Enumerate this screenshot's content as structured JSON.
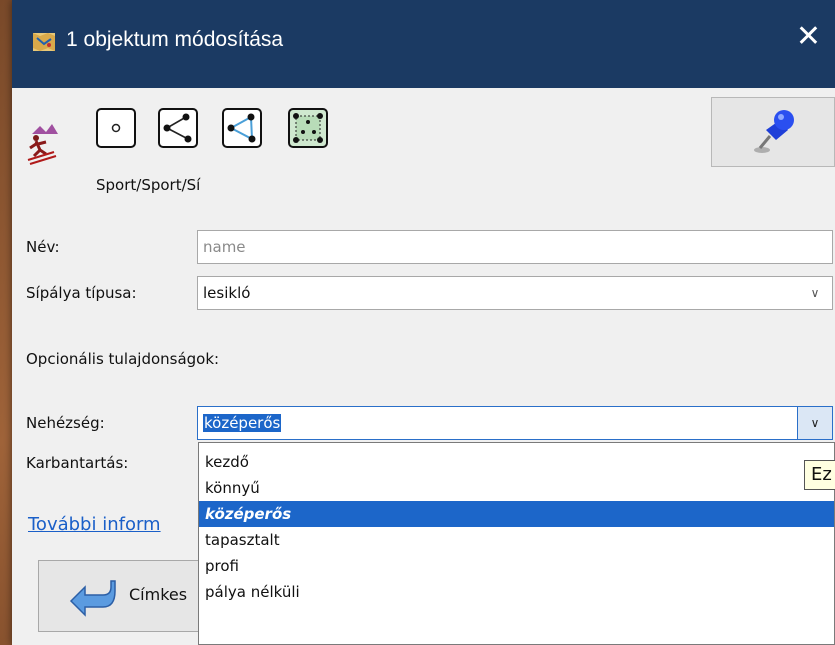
{
  "window": {
    "title": "1 objektum módosítása",
    "close_glyph": "✕"
  },
  "preset": {
    "icon": "skier-icon",
    "path": "Sport/Sport/Sí"
  },
  "geometry_buttons": [
    "point-icon",
    "line-icon",
    "closed-way-icon",
    "area-icon"
  ],
  "pin_button": {
    "icon": "pushpin-icon"
  },
  "form": {
    "name_label": "Név:",
    "name_placeholder": "name",
    "type_label": "Sípálya típusa:",
    "type_value": "lesikló",
    "optional_heading": "Opcionális tulajdonságok:",
    "difficulty_label": "Nehézség:",
    "difficulty_value": "középerős",
    "maintenance_label": "Karbantartás:"
  },
  "more_info_link": "További inform",
  "bottom_button": {
    "label": "Címkes",
    "icon": "back-arrow-icon"
  },
  "difficulty_options": [
    "kezdő",
    "könnyű",
    "középerős",
    "tapasztalt",
    "profi",
    "pálya nélküli"
  ],
  "difficulty_selected_index": 2,
  "tooltip": {
    "text": "Ez"
  },
  "colors": {
    "title_bar": "#1b3a63",
    "selection": "#1c66c9",
    "link": "#1a5fc8"
  }
}
